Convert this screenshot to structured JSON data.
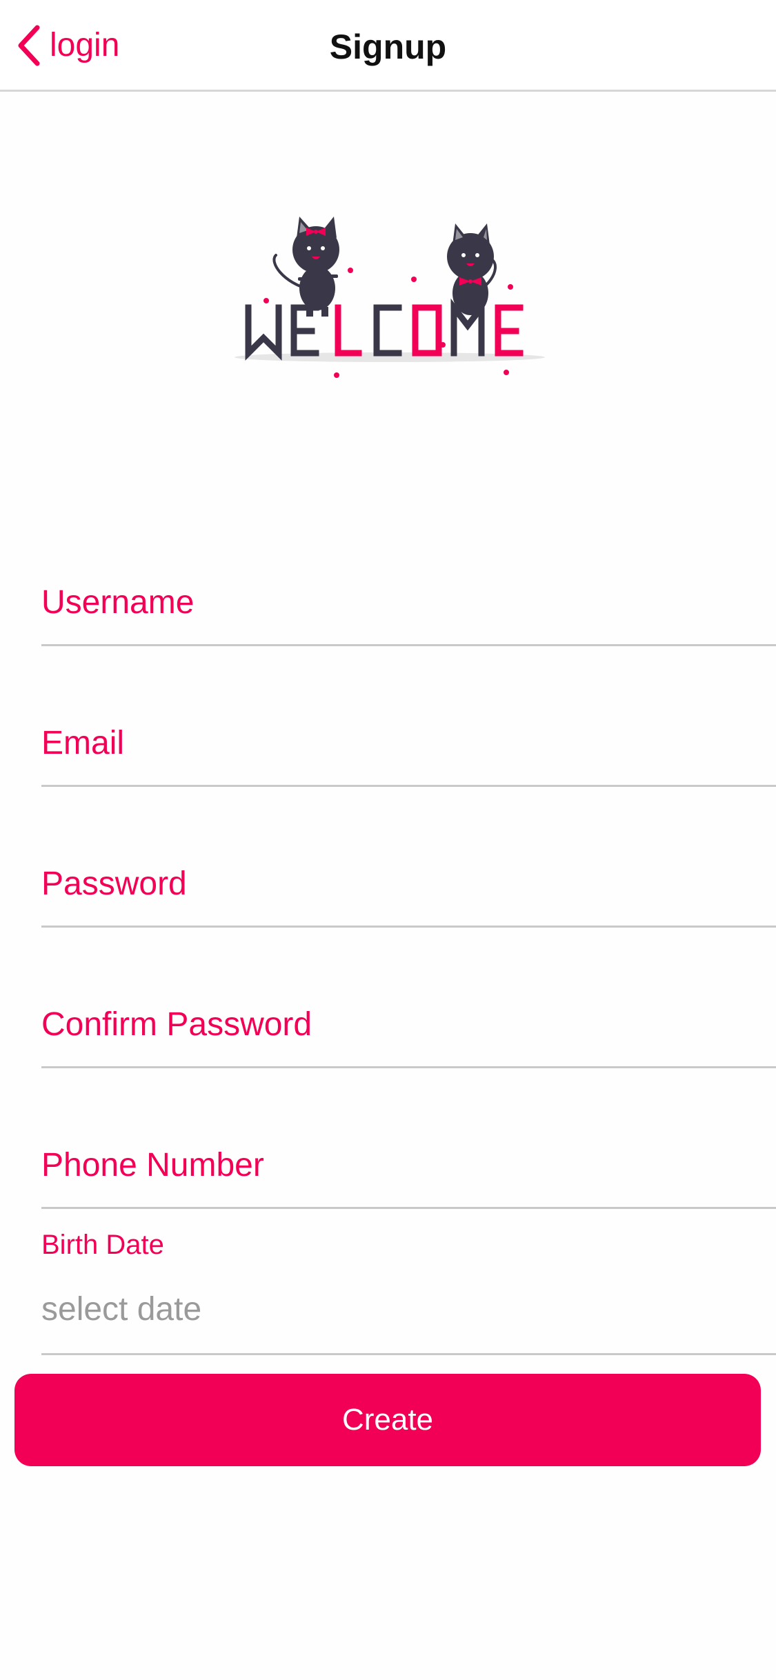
{
  "header": {
    "back_label": "login",
    "title": "Signup"
  },
  "illustration": {
    "word": "WELCOME",
    "description_icon": "welcome-cats-illustration"
  },
  "form": {
    "fields": [
      {
        "label": "Username"
      },
      {
        "label": "Email"
      },
      {
        "label": "Password"
      },
      {
        "label": "Confirm Password"
      },
      {
        "label": "Phone Number"
      }
    ],
    "birth_date": {
      "label": "Birth Date",
      "placeholder": "select date"
    },
    "submit_label": "Create"
  },
  "colors": {
    "accent": "#f20056",
    "dark": "#3a3848",
    "divider": "#c9c9c9",
    "placeholder": "#9a9a9a"
  },
  "icons": {
    "back": "chevron-left-icon"
  }
}
